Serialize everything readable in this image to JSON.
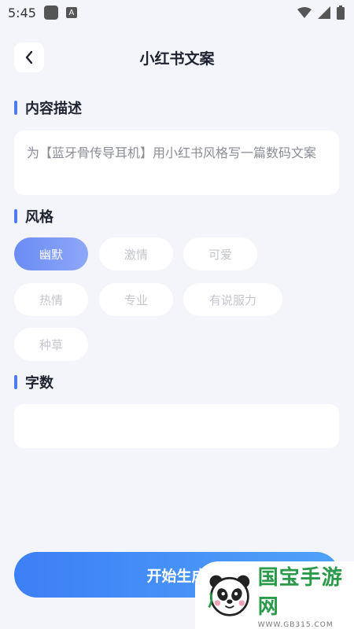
{
  "status_bar": {
    "time": "5:45",
    "a_glyph": "A"
  },
  "header": {
    "title": "小红书文案",
    "back_icon": "chevron-left-icon"
  },
  "content_section": {
    "title": "内容描述",
    "description": "为【蓝牙骨传导耳机】用小红书风格写一篇数码文案"
  },
  "style_section": {
    "title": "风格",
    "options": [
      "幽默",
      "激情",
      "可爱",
      "热情",
      "专业",
      "有说服力",
      "种草"
    ],
    "selected": "幽默"
  },
  "word_count_section": {
    "title": "字数",
    "value": ""
  },
  "start_button": {
    "label": "开始生成"
  },
  "watermark": {
    "brand_cn": "国宝手游网",
    "url": "WWW.GB315.COM"
  },
  "colors": {
    "accent": "#4f7cf0",
    "button_start": "#3d7ff6",
    "button_end": "#4fa2f8",
    "background": "#f3f5fa"
  }
}
